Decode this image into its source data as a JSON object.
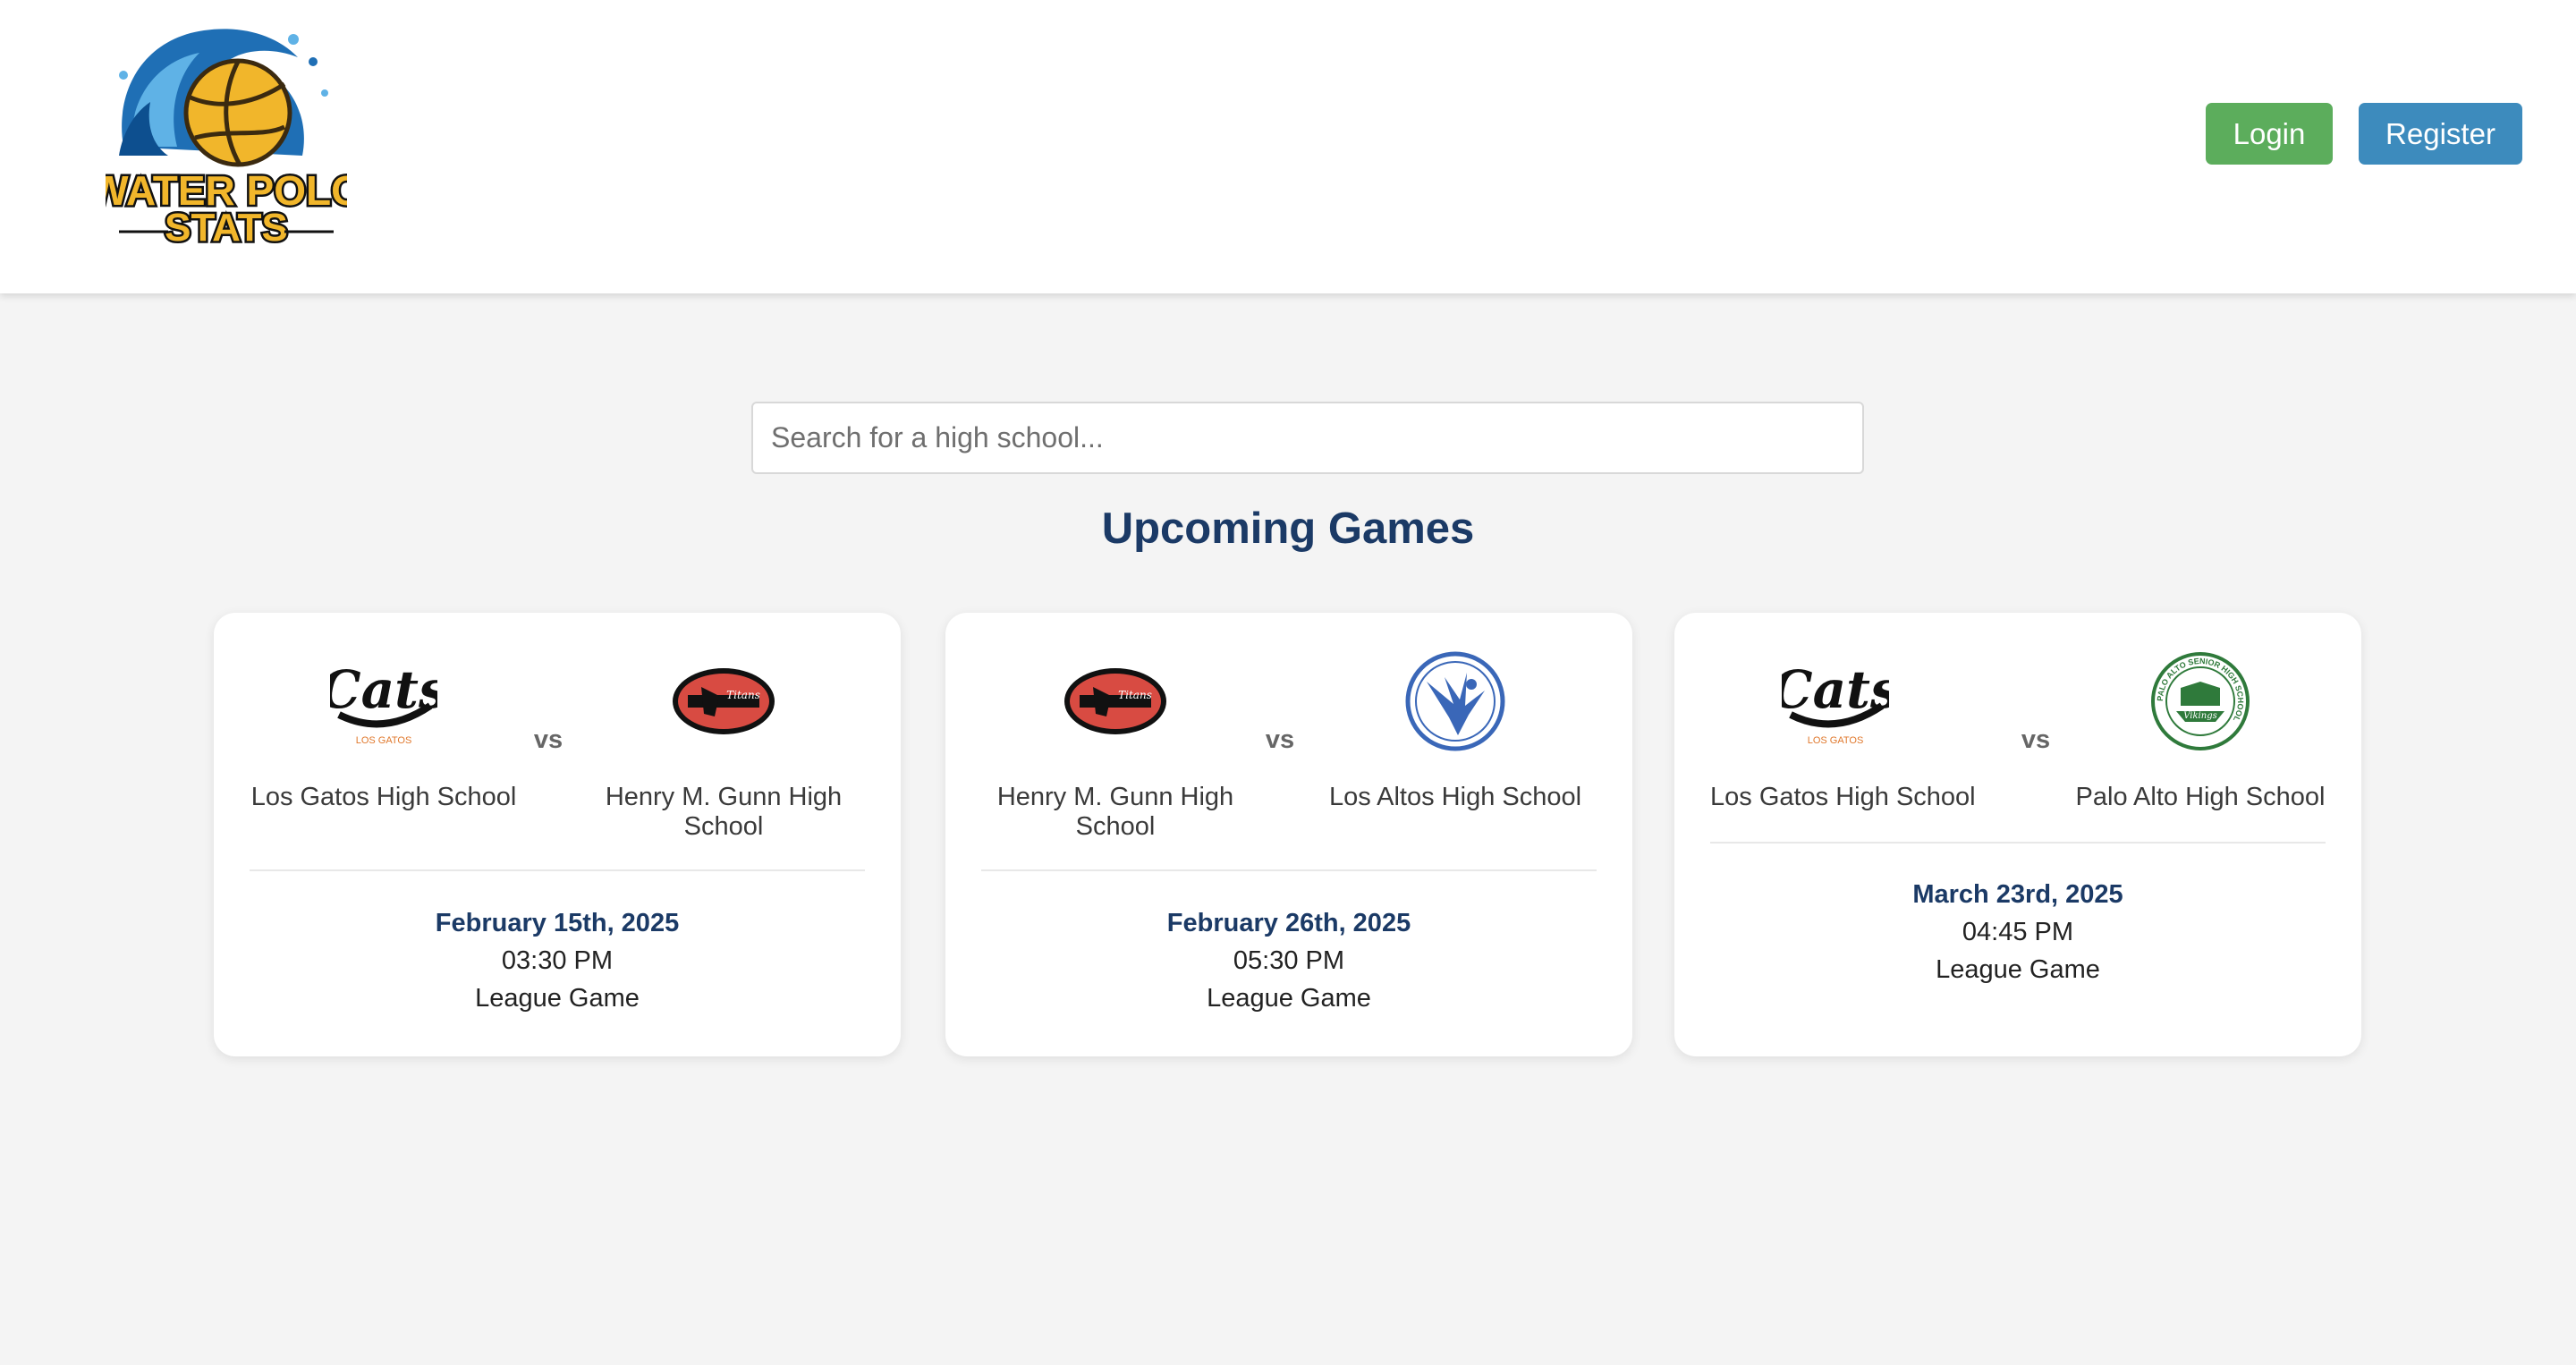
{
  "brand": {
    "logo_text_line1": "WATER POLO",
    "logo_text_line2": "STATS"
  },
  "header": {
    "login_label": "Login",
    "register_label": "Register"
  },
  "search": {
    "placeholder": "Search for a high school...",
    "value": ""
  },
  "section": {
    "title": "Upcoming Games"
  },
  "games": [
    {
      "home": {
        "name": "Los Gatos High School",
        "logo": "cats-logo"
      },
      "away": {
        "name": "Henry M. Gunn High School",
        "logo": "titans-logo"
      },
      "vs": "vs",
      "date": "February 15th, 2025",
      "time": "03:30 PM",
      "type": "League Game"
    },
    {
      "home": {
        "name": "Henry M. Gunn High School",
        "logo": "titans-logo"
      },
      "away": {
        "name": "Los Altos High School",
        "logo": "eagle-logo"
      },
      "vs": "vs",
      "date": "February 26th, 2025",
      "time": "05:30 PM",
      "type": "League Game"
    },
    {
      "home": {
        "name": "Los Gatos High School",
        "logo": "cats-logo"
      },
      "away": {
        "name": "Palo Alto High School",
        "logo": "vikings-logo"
      },
      "vs": "vs",
      "date": "March 23rd, 2025",
      "time": "04:45 PM",
      "type": "League Game"
    }
  ],
  "logo_text": {
    "cats": "Cats",
    "cats_sub": "LOS GATOS",
    "titans": "Titans",
    "vikings": "Vikings",
    "palo_alto_ring": "PALO ALTO SENIOR HIGH SCHOOL"
  },
  "colors": {
    "header_bg": "#ffffff",
    "page_bg": "#f4f4f4",
    "login": "#5cad5c",
    "register": "#3d8bbd",
    "heading": "#1b3a66"
  }
}
